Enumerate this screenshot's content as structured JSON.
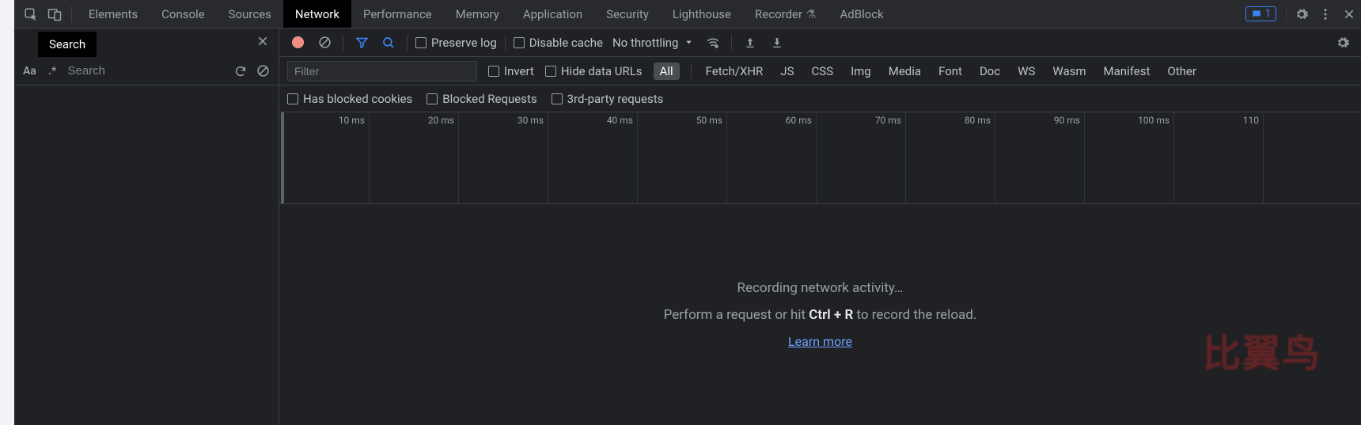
{
  "tabs": {
    "elements": "Elements",
    "console": "Console",
    "sources": "Sources",
    "network": "Network",
    "performance": "Performance",
    "memory": "Memory",
    "application": "Application",
    "security": "Security",
    "lighthouse": "Lighthouse",
    "recorder": "Recorder",
    "adblock": "AdBlock"
  },
  "issues_count": "1",
  "search_panel": {
    "tab_label": "Search",
    "placeholder": "Search"
  },
  "toolbar": {
    "preserve_log": "Preserve log",
    "disable_cache": "Disable cache",
    "throttling": "No throttling"
  },
  "filter": {
    "placeholder": "Filter",
    "invert": "Invert",
    "hide_data_urls": "Hide data URLs",
    "types": {
      "all": "All",
      "fetch": "Fetch/XHR",
      "js": "JS",
      "css": "CSS",
      "img": "Img",
      "media": "Media",
      "font": "Font",
      "doc": "Doc",
      "ws": "WS",
      "wasm": "Wasm",
      "manifest": "Manifest",
      "other": "Other"
    },
    "blocked_cookies": "Has blocked cookies",
    "blocked_requests": "Blocked Requests",
    "third_party": "3rd-party requests"
  },
  "timeline": {
    "ticks": [
      "10 ms",
      "20 ms",
      "30 ms",
      "40 ms",
      "50 ms",
      "60 ms",
      "70 ms",
      "80 ms",
      "90 ms",
      "100 ms",
      "110"
    ]
  },
  "empty": {
    "title": "Recording network activity…",
    "hint_before": "Perform a request or hit ",
    "hint_key": "Ctrl + R",
    "hint_after": " to record the reload.",
    "learn_more": "Learn more"
  }
}
